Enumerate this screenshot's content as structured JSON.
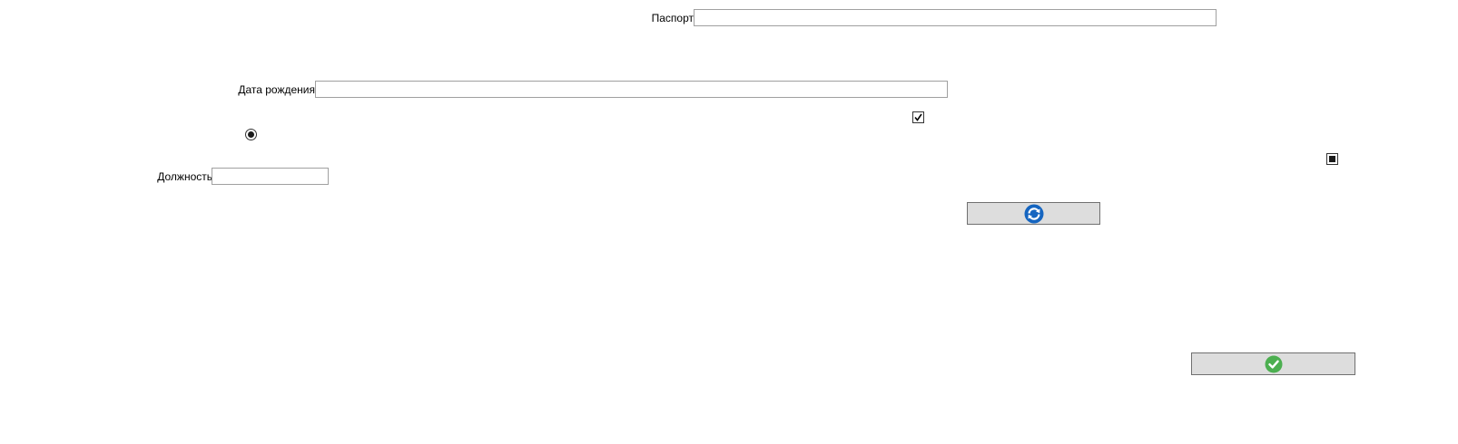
{
  "form": {
    "passport": {
      "label": "Паспорт",
      "value": ""
    },
    "birth_date": {
      "label": "Дата рождения",
      "value": ""
    },
    "position": {
      "label": "Должность",
      "value": ""
    },
    "checkbox": {
      "checked": true
    },
    "radio": {
      "selected": true
    },
    "tristate_checkbox": {
      "state": "indeterminate"
    }
  },
  "buttons": {
    "refresh": {
      "icon": "refresh-icon",
      "color": "#1565c0"
    },
    "ok": {
      "icon": "checkmark-icon",
      "color": "#4caf50"
    }
  }
}
